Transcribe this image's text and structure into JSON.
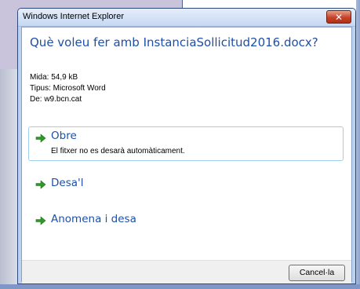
{
  "window": {
    "title": "Windows Internet Explorer",
    "close_glyph": "✕"
  },
  "dialog": {
    "question": "Què voleu fer amb InstanciaSollicitud2016.docx?",
    "file_info": {
      "size": "Mida: 54,9 kB",
      "type": "Tipus: Microsoft Word",
      "from": "De: w9.bcn.cat"
    },
    "options": [
      {
        "label": "Obre",
        "description": "El fitxer no es desarà automàticament.",
        "icon": "green-arrow-icon"
      },
      {
        "label": "Desa'l",
        "icon": "green-arrow-icon"
      },
      {
        "label": "Anomena i desa",
        "icon": "green-arrow-icon"
      }
    ],
    "cancel_label": "Cancel·la"
  },
  "colors": {
    "link_blue": "#1e4fa8",
    "arrow_green": "#2f9a2a",
    "close_red": "#c7432a",
    "selection_border": "#9ed0ee"
  }
}
